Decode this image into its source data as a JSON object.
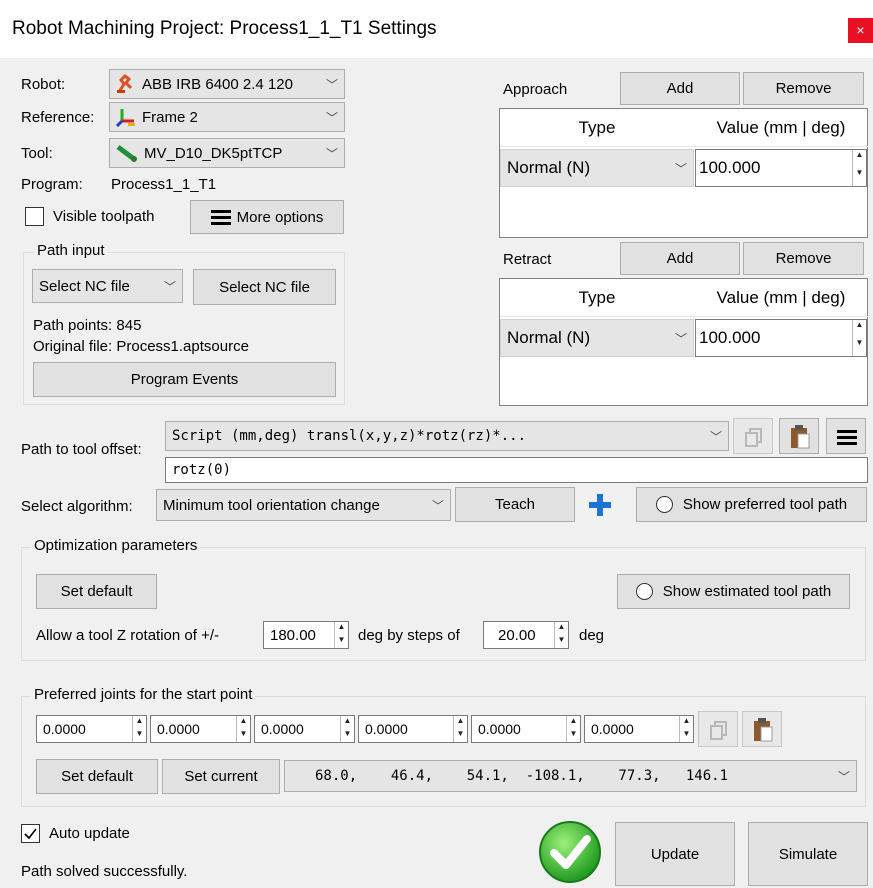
{
  "window": {
    "title": "Robot Machining Project: Process1_1_T1 Settings",
    "close_glyph": "×"
  },
  "robot": {
    "label": "Robot:",
    "value": "ABB IRB 6400 2.4 120"
  },
  "reference": {
    "label": "Reference:",
    "value": "Frame 2"
  },
  "tool": {
    "label": "Tool:",
    "value": "MV_D10_DK5ptTCP"
  },
  "program": {
    "label": "Program:",
    "value": "Process1_1_T1"
  },
  "visible_toolpath": {
    "label": "Visible toolpath",
    "checked": false
  },
  "more_options": {
    "label": "More options"
  },
  "path_input": {
    "group_label": "Path input",
    "select_value": "Select NC file",
    "select_button": "Select NC file",
    "path_points": "Path points: 845",
    "original_file": "Original file: Process1.aptsource",
    "events_button": "Program Events"
  },
  "approach": {
    "label": "Approach",
    "add": "Add",
    "remove": "Remove",
    "col_type": "Type",
    "col_value": "Value (mm | deg)",
    "row_type": "Normal (N)",
    "row_value": "100.000"
  },
  "retract": {
    "label": "Retract",
    "add": "Add",
    "remove": "Remove",
    "col_type": "Type",
    "col_value": "Value (mm | deg)",
    "row_type": "Normal (N)",
    "row_value": "100.000"
  },
  "tool_offset": {
    "label": "Path to tool offset:",
    "script": "Script (mm,deg) transl(x,y,z)*rotz(rz)*...",
    "expression": "rotz(0)"
  },
  "algorithm": {
    "label": "Select algorithm:",
    "value": "Minimum tool orientation change",
    "teach": "Teach",
    "show_preferred": "Show preferred tool path"
  },
  "optimization": {
    "group_label": "Optimization parameters",
    "set_default": "Set default",
    "show_estimated": "Show estimated tool path",
    "rotation_label": "Allow a tool Z rotation of +/-",
    "rotation_value": "180.00",
    "steps_label": "deg by steps of",
    "steps_value": "20.00",
    "deg_label": "deg"
  },
  "preferred_joints": {
    "group_label": "Preferred joints for the start point",
    "joints": [
      "0.0000",
      "0.0000",
      "0.0000",
      "0.0000",
      "0.0000",
      "0.0000"
    ],
    "set_default": "Set default",
    "set_current": "Set current",
    "current_values": "68.0,    46.4,    54.1,  -108.1,    77.3,   146.1"
  },
  "auto_update": {
    "label": "Auto update",
    "checked": true
  },
  "status": {
    "text": "Path solved successfully."
  },
  "actions": {
    "update": "Update",
    "simulate": "Simulate"
  },
  "colors": {
    "success": "#2fb82f",
    "close": "#e81123",
    "accent": "#1e73d6"
  }
}
